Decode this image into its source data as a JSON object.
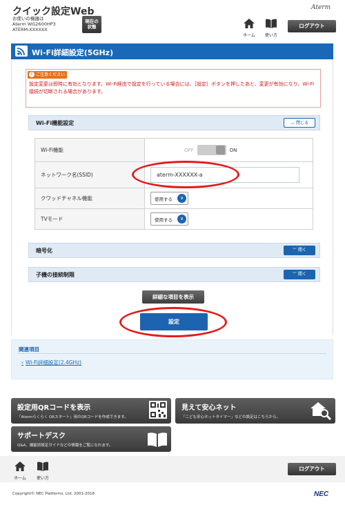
{
  "header": {
    "app_title": "クイック設定Web",
    "device_caption": "お使いの機器は",
    "model": "Aterm WG2600HP3",
    "device_name": "ATERM-XXXXXX",
    "status_button": "現在の\n状態",
    "status_line1": "現在の",
    "status_line2": "状態",
    "brand": "Aterm",
    "home_label": "ホーム",
    "manual_label": "使い方",
    "logout_label": "ログアウト"
  },
  "page_title": "Wi-Fi詳細設定(5GHz)",
  "caution": {
    "tag": "ご注意ください",
    "text": "設定変更は即時に有効となります。Wi-Fi経由で設定を行っている場合には、［設定］ボタンを押したあと、変更が有効になり、Wi-Fi接続が切断される場合があります。"
  },
  "sections": {
    "wifi_function": {
      "label": "Wi-Fi機能設定",
      "button": "閉じる",
      "state": "open"
    },
    "encryption": {
      "label": "暗号化",
      "button": "開く",
      "state": "closed"
    },
    "child_restriction": {
      "label": "子機の接続制限",
      "button": "開く",
      "state": "closed"
    }
  },
  "settings": {
    "wifi_function": {
      "label": "Wi-Fi機能",
      "off": "OFF",
      "on": "ON",
      "value": "ON"
    },
    "ssid": {
      "label": "ネットワーク名(SSID)",
      "value": "aterm-XXXXXX-a"
    },
    "quad_channel": {
      "label": "クワッドチャネル機能",
      "value": "使用する"
    },
    "tv_mode": {
      "label": "TVモード",
      "value": "使用する"
    }
  },
  "buttons": {
    "show_details": "詳細な項目を表示",
    "save": "設定"
  },
  "related": {
    "heading": "関連項目",
    "link": "Wi-Fi詳細設定(2.4GHz)"
  },
  "tiles": {
    "qr": {
      "title": "設定用QRコードを表示",
      "desc": "「Atermらくらく QRスタート」用のQRコードを作成できます。"
    },
    "safe_net": {
      "title": "見えて安心ネット",
      "desc": "「こども安心ネットタイマー」などの設定はこちらから。"
    },
    "support": {
      "title": "サポートデスク",
      "desc": "Q&A、機能別設定ガイドなどの情報をご覧になれます。"
    }
  },
  "footer": {
    "home_label": "ホーム",
    "manual_label": "使い方",
    "logout_label": "ログアウト",
    "copyright": "Copyright© NEC Platforms, Ltd. 2001-2018",
    "brand": "NEC"
  },
  "colors": {
    "primary_blue": "#1969b8",
    "caution_red": "#d0161b",
    "caution_orange": "#e8721a",
    "annotation_red": "#e21c1c"
  }
}
